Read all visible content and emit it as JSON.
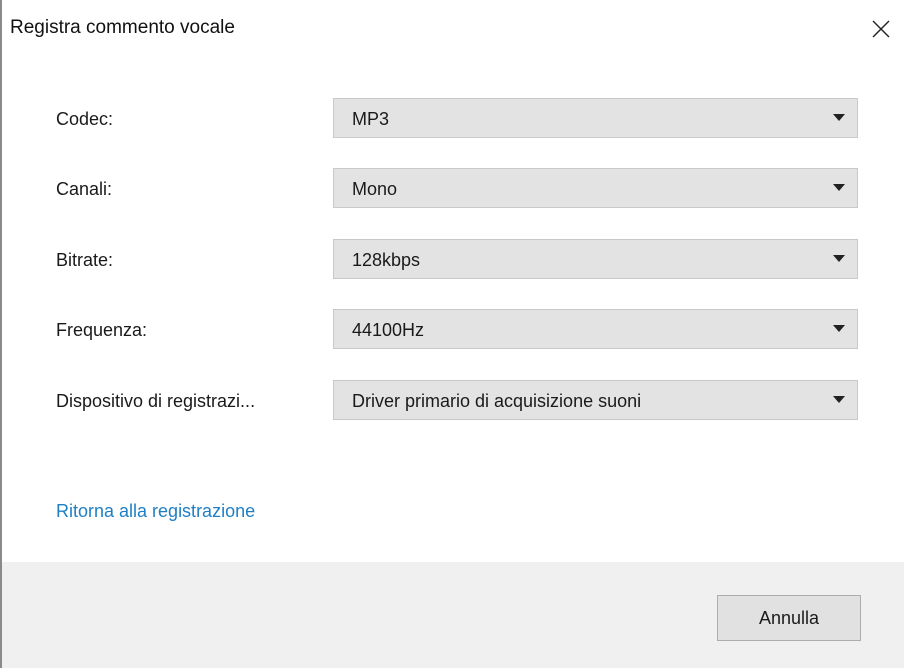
{
  "window": {
    "title": "Registra commento vocale",
    "close_icon": "close-icon"
  },
  "settings": [
    {
      "label": "Codec:",
      "value": "MP3"
    },
    {
      "label": "Canali:",
      "value": "Mono"
    },
    {
      "label": "Bitrate:",
      "value": "128kbps"
    },
    {
      "label": "Frequenza:",
      "value": "44100Hz"
    },
    {
      "label": "Dispositivo di registrazi...",
      "value": "Driver primario di acquisizione suoni"
    }
  ],
  "link": {
    "label": "Ritorna alla registrazione",
    "color": "#1f7fc4"
  },
  "footer": {
    "cancel_label": "Annulla"
  },
  "colors": {
    "select_bg": "#e3e3e3",
    "footer_bg": "#f0f0f0",
    "link": "#1f7fc4"
  }
}
